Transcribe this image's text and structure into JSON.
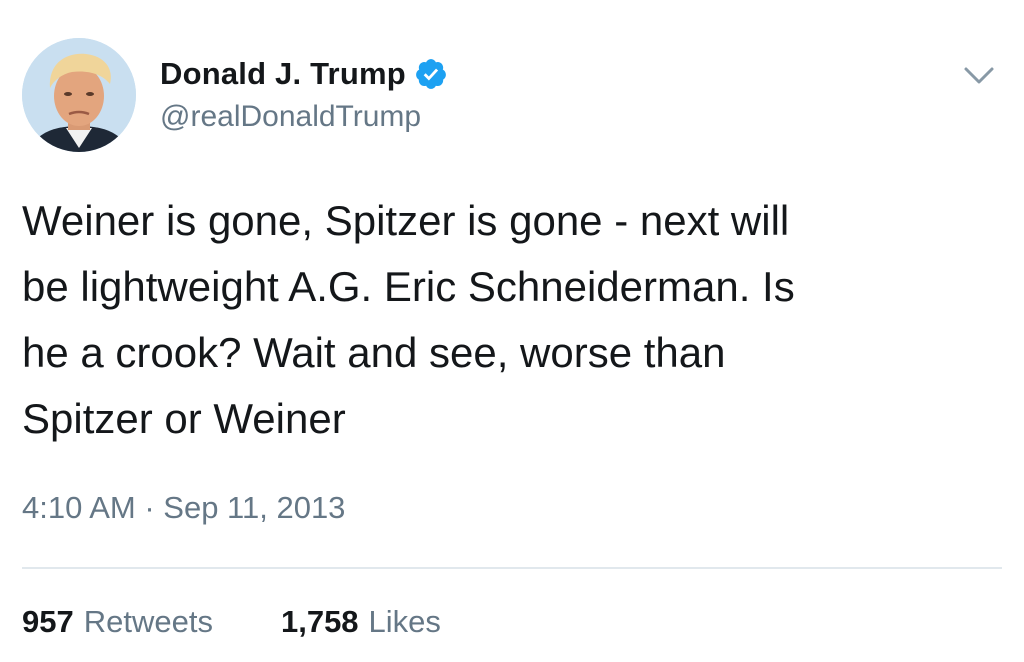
{
  "tweet": {
    "author": {
      "display_name": "Donald J. Trump",
      "handle": "@realDonaldTrump",
      "verified": true,
      "avatar_icon": "profile-photo-icon"
    },
    "menu_icon": "chevron-down-icon",
    "text": "Weiner is gone, Spitzer is gone - next will\nbe lightweight A.G. Eric Schneiderman. Is\nhe a crook? Wait and see, worse than\nSpitzer or Weiner",
    "timestamp": "4:10 AM · Sep 11, 2013",
    "stats": {
      "retweets_count": "957",
      "retweets_label": "Retweets",
      "likes_count": "1,758",
      "likes_label": "Likes"
    }
  },
  "colors": {
    "text_primary": "#14171a",
    "text_secondary": "#657786",
    "verified_blue": "#1da1f2",
    "divider": "#e1e8ed",
    "background": "#ffffff"
  }
}
